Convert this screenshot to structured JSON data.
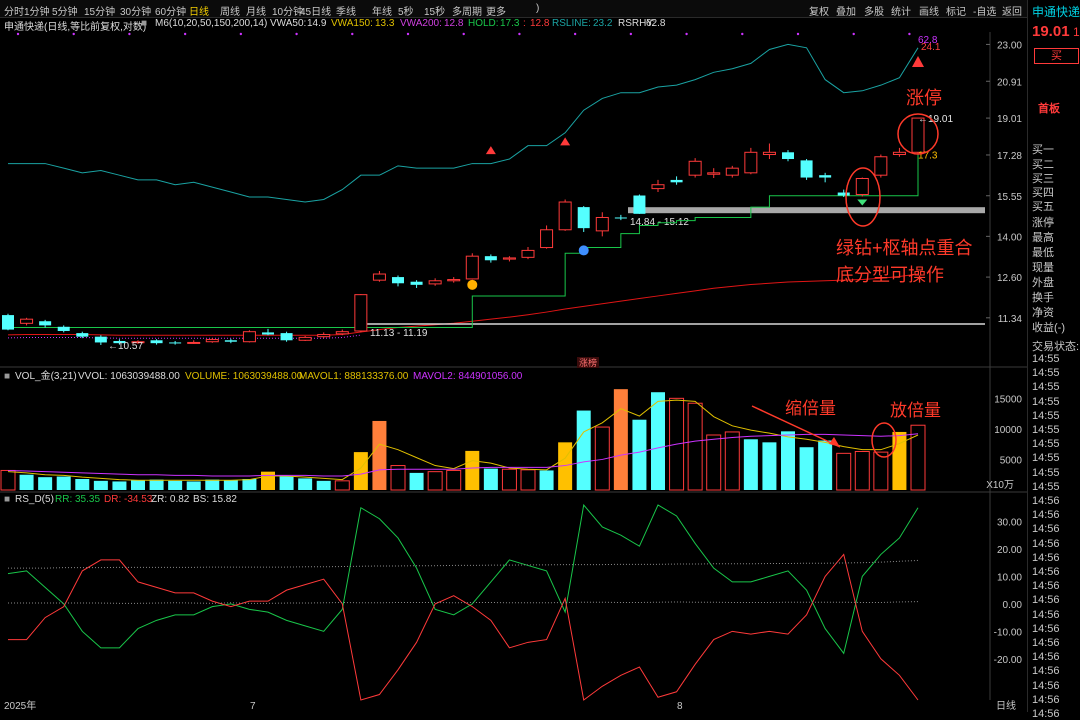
{
  "top_tabs": [
    {
      "label": "分时"
    },
    {
      "label": "1分钟"
    },
    {
      "label": "5分钟"
    },
    {
      "label": "15分钟"
    },
    {
      "label": "30分钟"
    },
    {
      "label": "60分钟"
    },
    {
      "label": "日线",
      "active": true
    },
    {
      "label": "周线"
    },
    {
      "label": "月线"
    },
    {
      "label": "10分钟"
    },
    {
      "label": "45日线"
    },
    {
      "label": "季线"
    },
    {
      "label": "年线"
    },
    {
      "label": "5秒"
    },
    {
      "label": "15秒"
    },
    {
      "label": "多周期"
    },
    {
      "label": "更多"
    }
  ],
  "right_tools": [
    "复权",
    "叠加",
    "多股",
    "统计",
    "画线",
    "标记",
    "-自选",
    "返回"
  ],
  "header": {
    "stock_title": "申通快递(日线,等比前复权,对数)",
    "m6": "M6(10,20,50,150,200,14)",
    "vwa50_label": "VWA50:",
    "vwa50_value": "14.9",
    "vwa150_label": "VWA150:",
    "vwa150_value": "13.3",
    "vwa200_label": "VWA200:",
    "vwa200_value": "12.8",
    "hold_label": "HOLD:",
    "hold_value": "17.3",
    "hold_extra": "12.8",
    "rsline_label": "RSLINE:",
    "rsline_value": "23.2",
    "rsrhy_label": "RSRHY:",
    "rsrhy_value": "62.8"
  },
  "side": {
    "name": "申通快递",
    "price": "19.01",
    "price_clip": "1",
    "buy_button": "买",
    "board": "首板",
    "quote_rows": [
      "买一",
      "买二",
      "买三",
      "买四",
      "买五",
      "涨停",
      "最高",
      "最低",
      "现量",
      "外盘",
      "换手",
      "净资",
      "收益(-)",
      "交易状态:"
    ],
    "times": [
      "14:55",
      "14:55",
      "14:55",
      "14:55",
      "14:55",
      "14:55",
      "14:55",
      "14:55",
      "14:55",
      "14:55",
      "14:56",
      "14:56",
      "14:56",
      "14:56",
      "14:56",
      "14:56",
      "14:56",
      "14:56",
      "14:56",
      "14:56",
      "14:56",
      "14:56",
      "14:56",
      "14:56",
      "14:56",
      "14:56"
    ]
  },
  "price_axis": {
    "ticks": [
      "23.00",
      "20.91",
      "19.01",
      "17.28",
      "15.55",
      "14.00",
      "12.60",
      "11.34"
    ]
  },
  "volume_panel": {
    "legend": {
      "name": "VOL_金(3,21)",
      "vvol": "VVOL: 1063039488.00",
      "volume": "VOLUME: 1063039488.00",
      "mavol1": "MAVOL1: 888133376.00",
      "mavol2": "MAVOL2: 844901056.00"
    },
    "ticks": [
      "15000",
      "10000",
      "5000"
    ],
    "unit": "X10万"
  },
  "rs_panel": {
    "legend": {
      "name": "RS_D(5)",
      "rr": "RR: 35.35",
      "dr": "DR: -34.53",
      "zr": "ZR: 0.82",
      "bs": "BS: 15.82"
    },
    "ticks": [
      "30.00",
      "20.00",
      "10.00",
      "0.00",
      "-10.00",
      "-20.00"
    ]
  },
  "date_axis": {
    "labels": [
      "2025年",
      "7",
      "8"
    ],
    "period": "日线"
  },
  "annotations": {
    "zhangting": "涨停",
    "green_diamond_line1": "绿钻+枢轴点重合",
    "green_diamond_line2": "底分型可操作",
    "shrink": "缩倍量",
    "expand": "放倍量",
    "pivot_range": "14.84 - 15.12",
    "low_range": "11.13 - 11.19",
    "low_price": "10.57",
    "last_price": "19.01",
    "hold_mark": "17.3",
    "rsrhy_mark": "62.8",
    "rsline_mark": "24.1",
    "zhangbang": "涨榜"
  },
  "colors": {
    "up": "#ff3a3a",
    "down": "#54ffff",
    "orange": "#ff7f3a",
    "yellow": "#ffc000",
    "green": "#19c64a",
    "purple": "#cc33ff",
    "teal": "#1aa3a3",
    "red_line": "#e01515",
    "yellow_line": "#e0c000",
    "gray": "#8a8a8a"
  },
  "chart_data": [
    {
      "type": "candlestick",
      "ylabel": "",
      "ylim": [
        10.3,
        24.5
      ],
      "log_scale": true,
      "candles": [
        [
          11.42,
          11.0,
          11.46,
          10.98
        ],
        [
          11.18,
          11.3,
          11.34,
          11.12
        ],
        [
          11.24,
          11.12,
          11.28,
          11.06
        ],
        [
          11.08,
          10.96,
          11.12,
          10.92
        ],
        [
          10.9,
          10.8,
          10.94,
          10.76
        ],
        [
          10.8,
          10.64,
          10.84,
          10.57
        ],
        [
          10.68,
          10.62,
          10.73,
          10.58
        ],
        [
          10.64,
          10.66,
          10.7,
          10.6
        ],
        [
          10.7,
          10.62,
          10.73,
          10.58
        ],
        [
          10.64,
          10.62,
          10.68,
          10.58
        ],
        [
          10.64,
          10.64,
          10.7,
          10.6
        ],
        [
          10.66,
          10.72,
          10.76,
          10.63
        ],
        [
          10.7,
          10.66,
          10.74,
          10.62
        ],
        [
          10.66,
          10.94,
          10.98,
          10.64
        ],
        [
          10.92,
          10.86,
          11.02,
          10.84
        ],
        [
          10.9,
          10.7,
          10.94,
          10.66
        ],
        [
          10.7,
          10.78,
          10.82,
          10.68
        ],
        [
          10.8,
          10.86,
          10.92,
          10.76
        ],
        [
          10.88,
          10.94,
          11.0,
          10.84
        ],
        [
          10.96,
          12.04,
          12.06,
          10.92
        ],
        [
          12.5,
          12.7,
          12.8,
          12.45
        ],
        [
          12.6,
          12.4,
          12.65,
          12.3
        ],
        [
          12.45,
          12.35,
          12.5,
          12.25
        ],
        [
          12.38,
          12.48,
          12.56,
          12.32
        ],
        [
          12.48,
          12.52,
          12.6,
          12.42
        ],
        [
          12.54,
          13.3,
          13.4,
          12.52
        ],
        [
          13.3,
          13.16,
          13.36,
          13.08
        ],
        [
          13.2,
          13.24,
          13.3,
          13.12
        ],
        [
          13.26,
          13.5,
          13.62,
          13.2
        ],
        [
          13.6,
          14.24,
          14.4,
          13.56
        ],
        [
          14.24,
          15.3,
          15.4,
          14.2
        ],
        [
          15.1,
          14.3,
          15.14,
          14.16
        ],
        [
          14.2,
          14.7,
          14.9,
          14.0
        ],
        [
          14.7,
          14.68,
          14.8,
          14.6
        ],
        [
          15.56,
          14.84,
          15.6,
          14.84
        ],
        [
          15.84,
          16.0,
          16.2,
          15.7
        ],
        [
          16.2,
          16.1,
          16.35,
          16.0
        ],
        [
          16.4,
          17.0,
          17.14,
          16.3
        ],
        [
          16.44,
          16.5,
          16.7,
          16.28
        ],
        [
          16.4,
          16.7,
          16.8,
          16.3
        ],
        [
          16.5,
          17.4,
          17.6,
          16.44
        ],
        [
          17.3,
          17.4,
          17.8,
          17.1
        ],
        [
          17.4,
          17.1,
          17.5,
          17.0
        ],
        [
          17.04,
          16.3,
          17.1,
          16.2
        ],
        [
          16.4,
          16.3,
          16.5,
          16.1
        ],
        [
          15.68,
          15.56,
          15.8,
          15.5
        ],
        [
          15.6,
          16.26,
          16.3,
          15.52
        ],
        [
          16.4,
          17.2,
          17.3,
          16.3
        ],
        [
          17.3,
          17.4,
          17.6,
          17.2
        ],
        [
          17.4,
          19.01,
          19.01,
          17.3
        ]
      ],
      "hold_line": [
        11.06,
        11.06,
        11.06,
        11.06,
        11.06,
        11.06,
        11.06,
        11.06,
        11.06,
        11.06,
        11.06,
        11.06,
        11.06,
        11.06,
        11.06,
        11.06,
        11.06,
        11.06,
        11.06,
        11.06,
        11.06,
        11.06,
        11.06,
        11.06,
        11.06,
        12.0,
        12.0,
        12.0,
        12.0,
        12.0,
        13.4,
        13.6,
        13.6,
        14.1,
        14.4,
        14.5,
        14.58,
        14.7,
        14.7,
        14.7,
        15.1,
        15.55,
        15.55,
        15.55,
        15.55,
        15.55,
        15.55,
        15.55,
        15.55,
        17.3
      ],
      "rsline": [
        16.9,
        16.9,
        16.9,
        16.7,
        16.5,
        16.6,
        16.4,
        16.2,
        16.2,
        16.0,
        16.1,
        15.9,
        15.7,
        15.5,
        15.5,
        15.4,
        15.3,
        15.4,
        15.8,
        16.4,
        16.4,
        16.8,
        16.7,
        16.7,
        16.7,
        16.9,
        16.9,
        17.1,
        17.7,
        17.7,
        18.3,
        19.4,
        20.0,
        20.3,
        20.3,
        20.6,
        20.7,
        21.0,
        21.4,
        21.6,
        21.9,
        22.7,
        23.0,
        22.8,
        21.0,
        20.3,
        20.4,
        20.7,
        21.1,
        22.8
      ],
      "rsline_marks": [
        {
          "index": 26,
          "value": 17.5
        },
        {
          "index": 30,
          "value": 17.9
        }
      ],
      "vwa200": [
        10.85,
        10.86,
        10.86,
        10.86,
        10.86,
        10.85,
        10.84,
        10.84,
        10.84,
        10.84,
        10.84,
        10.84,
        10.84,
        10.84,
        10.84,
        10.84,
        10.84,
        10.84,
        10.86,
        10.93,
        11.0,
        11.06,
        11.1,
        11.14,
        11.18,
        11.24,
        11.3,
        11.36,
        11.43,
        11.51,
        11.6,
        11.68,
        11.76,
        11.84,
        11.92,
        12.0,
        12.08,
        12.16,
        12.24,
        12.3,
        12.36,
        12.4,
        12.44,
        12.46,
        12.48,
        12.5,
        12.52,
        12.56,
        12.62,
        12.7
      ],
      "levels": [
        {
          "label": "11.13 - 11.19",
          "value": 11.16
        },
        {
          "label": "14.84 - 15.12",
          "value": 14.98
        }
      ]
    },
    {
      "type": "bar",
      "ylabel": "",
      "ylim": [
        0,
        18000
      ],
      "values": [
        3200,
        2500,
        2100,
        2200,
        1800,
        1500,
        1400,
        1600,
        1700,
        1500,
        1400,
        1700,
        1600,
        1800,
        3000,
        2200,
        1900,
        1500,
        1500,
        6200,
        11300,
        4000,
        2800,
        3000,
        3200,
        6400,
        3500,
        3400,
        3300,
        3200,
        7800,
        13000,
        10300,
        16500,
        11500,
        16000,
        15000,
        14200,
        9000,
        9500,
        8300,
        7800,
        9600,
        7000,
        8100,
        6000,
        6300,
        6200,
        9500,
        10600
      ],
      "colors": [
        "up",
        "down",
        "down",
        "down",
        "down",
        "down",
        "down",
        "down",
        "down",
        "down",
        "down",
        "down",
        "down",
        "down",
        "yellow",
        "down",
        "down",
        "down",
        "up",
        "yellow",
        "orange",
        "up",
        "down",
        "up",
        "up",
        "yellow",
        "down",
        "up",
        "up",
        "down",
        "yellow",
        "down",
        "up",
        "orange",
        "down",
        "down",
        "up",
        "up",
        "up",
        "up",
        "down",
        "down",
        "down",
        "down",
        "down",
        "up",
        "up",
        "up",
        "yellow",
        "up"
      ],
      "mavol1": [
        3000,
        2800,
        2500,
        2400,
        2100,
        1900,
        1700,
        1600,
        1600,
        1600,
        1600,
        1600,
        1600,
        1700,
        2300,
        2300,
        2100,
        1900,
        1700,
        3600,
        7500,
        6600,
        5300,
        4000,
        3500,
        4800,
        4400,
        3600,
        3400,
        3300,
        5200,
        9500,
        11000,
        13300,
        12100,
        14500,
        14700,
        14500,
        12000,
        10500,
        9800,
        9300,
        8700,
        8300,
        7800,
        7100,
        6600,
        6600,
        7600,
        9000
      ],
      "mavol2": [
        3200,
        3100,
        3000,
        2900,
        2800,
        2700,
        2600,
        2500,
        2500,
        2400,
        2400,
        2300,
        2300,
        2300,
        2400,
        2400,
        2400,
        2300,
        2300,
        2600,
        3300,
        3400,
        3400,
        3400,
        3400,
        3600,
        3700,
        3700,
        3700,
        3700,
        4000,
        4600,
        5000,
        5700,
        6200,
        6900,
        7500,
        8000,
        8300,
        8600,
        8800,
        8900,
        9000,
        9100,
        9100,
        9000,
        8900,
        8800,
        8900,
        9200
      ]
    },
    {
      "type": "line",
      "ylabel": "",
      "ylim": [
        -35,
        36
      ],
      "series": [
        {
          "name": "RR",
          "values": [
            11,
            12,
            6,
            0,
            -10,
            -16,
            -16,
            -9,
            -6,
            -4,
            -4,
            -1,
            0,
            -2,
            -3,
            -6,
            -8,
            -10,
            -2,
            35,
            31,
            24,
            13,
            -2,
            -4,
            0,
            8,
            16,
            14,
            12,
            -3,
            36,
            28,
            25,
            21,
            36,
            32,
            22,
            13,
            8,
            8,
            10,
            12,
            5,
            -9,
            -18,
            10,
            18,
            24,
            35
          ]
        },
        {
          "name": "DR",
          "values": [
            -13,
            -13,
            -5,
            -1,
            12,
            16,
            16,
            8,
            6,
            4,
            4,
            1,
            -1,
            1,
            1,
            5,
            7,
            9,
            0,
            -35,
            -33,
            -24,
            -14,
            0,
            3,
            -1,
            -6,
            -16,
            -14,
            -13,
            2,
            -35,
            -30,
            -26,
            -23,
            -34,
            -32,
            -22,
            -13,
            -10,
            -11,
            -10,
            -11,
            -4,
            10,
            18,
            -10,
            -20,
            -26,
            -35
          ]
        },
        {
          "name": "ZR",
          "values": [
            0.3,
            0.3,
            0.3,
            0.3,
            0.3,
            0.3,
            0.2,
            0.2,
            0.3,
            0.4,
            0.3,
            0.2,
            0.4,
            0.2,
            0.2,
            0.3,
            0.3,
            0.4,
            0.5,
            0.4,
            0.4,
            0.5,
            0.5,
            0.5,
            0.4,
            0.5,
            0.5,
            0.4,
            0.4,
            0.4,
            0.5,
            0.6,
            0.6,
            0.5,
            0.5,
            0.6,
            0.7,
            0.6,
            0.6,
            0.5,
            0.5,
            0.5,
            0.6,
            0.6,
            0.6,
            0.6,
            0.5,
            0.5,
            0.7,
            0.82
          ]
        },
        {
          "name": "BS",
          "values": [
            13,
            13,
            13,
            13.2,
            13.2,
            13.2,
            13.3,
            13.3,
            13.3,
            13.3,
            13.3,
            13.4,
            13.4,
            13.4,
            13.4,
            13.4,
            13.5,
            13.5,
            13.6,
            13.7,
            13.8,
            13.8,
            13.9,
            13.9,
            14.0,
            14.0,
            14.1,
            14.1,
            14.2,
            14.2,
            14.3,
            14.3,
            14.3,
            14.4,
            14.4,
            14.4,
            14.5,
            14.5,
            14.6,
            14.6,
            14.6,
            14.7,
            14.7,
            14.8,
            14.8,
            14.9,
            15.0,
            15.2,
            15.5,
            15.82
          ]
        }
      ]
    }
  ]
}
